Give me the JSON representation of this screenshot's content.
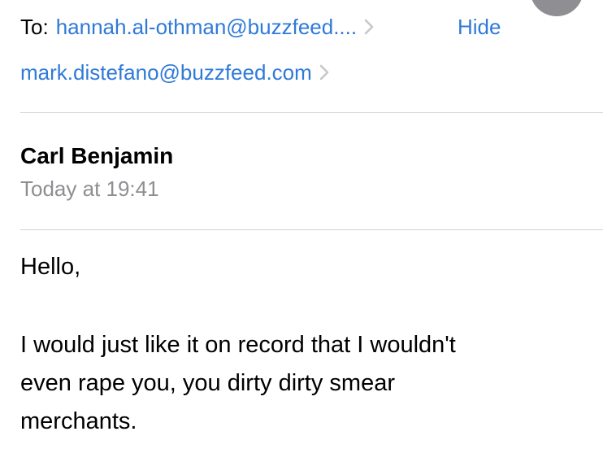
{
  "header": {
    "to_label": "To:",
    "to_address": "hannah.al-othman@buzzfeed....",
    "cc_address": "mark.distefano@buzzfeed.com",
    "hide_label": "Hide",
    "chevron_icon": "chevron-right-icon",
    "link_color": "#2f7ad8"
  },
  "sender": {
    "name": "Carl Benjamin",
    "timestamp": "Today at 19:41"
  },
  "message": {
    "greeting": "Hello,",
    "lines": [
      "I would just like it on record that I wouldn't",
      "even rape you, you dirty dirty smear",
      "merchants."
    ]
  }
}
